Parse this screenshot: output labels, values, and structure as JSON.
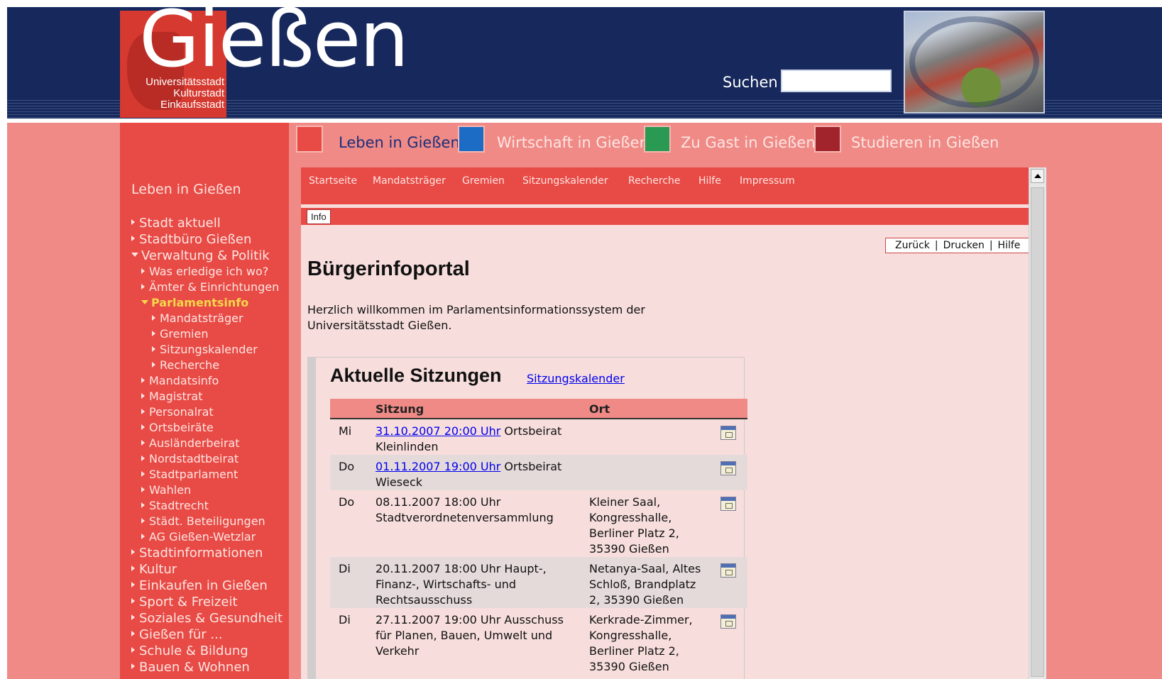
{
  "header": {
    "logo_text": "Gießen",
    "logo_sub": [
      "Universitätsstadt",
      "Kulturstadt",
      "Einkaufsstadt"
    ],
    "search_label": "Suchen",
    "search_value": ""
  },
  "categories": [
    {
      "label": "Leben in Gießen",
      "color": "#e84a45",
      "label_color": "#1c2f7a"
    },
    {
      "label": "Wirtschaft in Gießen",
      "color": "#1c6bc4",
      "label_color": "#fde5e2"
    },
    {
      "label": "Zu Gast in Gießen",
      "color": "#2a9a52",
      "label_color": "#fde5e2"
    },
    {
      "label": "Studieren in Gießen",
      "color": "#a1242d",
      "label_color": "#fde5e2"
    }
  ],
  "sidebar": {
    "title": "Leben in Gießen",
    "items": [
      {
        "label": "Stadt aktuell",
        "level": 1
      },
      {
        "label": "Stadtbüro Gießen",
        "level": 1
      },
      {
        "label": "Verwaltung & Politik",
        "level": 1,
        "open": true
      },
      {
        "label": "Was erledige ich wo?",
        "level": 2
      },
      {
        "label": "Ämter & Einrichtungen",
        "level": 2
      },
      {
        "label": "Parlamentsinfo",
        "level": 2,
        "open": true,
        "active": true
      },
      {
        "label": "Mandatsträger",
        "level": 3
      },
      {
        "label": "Gremien",
        "level": 3
      },
      {
        "label": "Sitzungskalender",
        "level": 3
      },
      {
        "label": "Recherche",
        "level": 3
      },
      {
        "label": "Mandatsinfo",
        "level": 2
      },
      {
        "label": "Magistrat",
        "level": 2
      },
      {
        "label": "Personalrat",
        "level": 2
      },
      {
        "label": "Ortsbeiräte",
        "level": 2
      },
      {
        "label": "Ausländerbeirat",
        "level": 2
      },
      {
        "label": "Nordstadtbeirat",
        "level": 2
      },
      {
        "label": "Stadtparlament",
        "level": 2
      },
      {
        "label": "Wahlen",
        "level": 2
      },
      {
        "label": "Stadtrecht",
        "level": 2
      },
      {
        "label": "Städt. Beteiligungen",
        "level": 2
      },
      {
        "label": "AG Gießen-Wetzlar",
        "level": 2
      },
      {
        "label": "Stadtinformationen",
        "level": 1
      },
      {
        "label": "Kultur",
        "level": 1
      },
      {
        "label": "Einkaufen in Gießen",
        "level": 1
      },
      {
        "label": "Sport & Freizeit",
        "level": 1
      },
      {
        "label": "Soziales & Gesundheit",
        "level": 1
      },
      {
        "label": "Gießen für ...",
        "level": 1
      },
      {
        "label": "Schule & Bildung",
        "level": 1
      },
      {
        "label": "Bauen & Wohnen",
        "level": 1
      }
    ]
  },
  "topnav": [
    "Startseite",
    "Mandatsträger",
    "Gremien",
    "Sitzungskalender",
    "Recherche",
    "Hilfe",
    "Impressum"
  ],
  "info_tab": "Info",
  "actions": [
    "Zurück",
    "Drucken",
    "Hilfe"
  ],
  "page_title": "Bürgerinfoportal",
  "intro": "Herzlich willkommen im Parlamentsinformationssystem der Universitätsstadt Gießen.",
  "sessions": {
    "title": "Aktuelle Sitzungen",
    "link": "Sitzungskalender",
    "columns": [
      "Sitzung",
      "Ort"
    ],
    "rows": [
      {
        "day": "Mi",
        "date_link": "31.10.2007 20:00 Uhr",
        "text": "Ortsbeirat Kleinlinden",
        "ort": ""
      },
      {
        "day": "Do",
        "date_link": "01.11.2007 19:00 Uhr",
        "text": "Ortsbeirat Wieseck",
        "ort": ""
      },
      {
        "day": "Do",
        "date_link": "",
        "text": "08.11.2007 18:00 Uhr Stadtverordnetenversammlung",
        "ort": "Kleiner Saal, Kongresshalle, Berliner Platz 2, 35390 Gießen"
      },
      {
        "day": "Di",
        "date_link": "",
        "text": "20.11.2007 18:00 Uhr Haupt-, Finanz-, Wirtschafts- und Rechtsausschuss",
        "ort": "Netanya-Saal, Altes Schloß, Brandplatz 2, 35390 Gießen"
      },
      {
        "day": "Di",
        "date_link": "",
        "text": "27.11.2007 19:00 Uhr Ausschuss für Planen, Bauen, Umwelt und Verkehr",
        "ort": "Kerkrade-Zimmer, Kongresshalle, Berliner Platz 2, 35390 Gießen"
      }
    ]
  }
}
